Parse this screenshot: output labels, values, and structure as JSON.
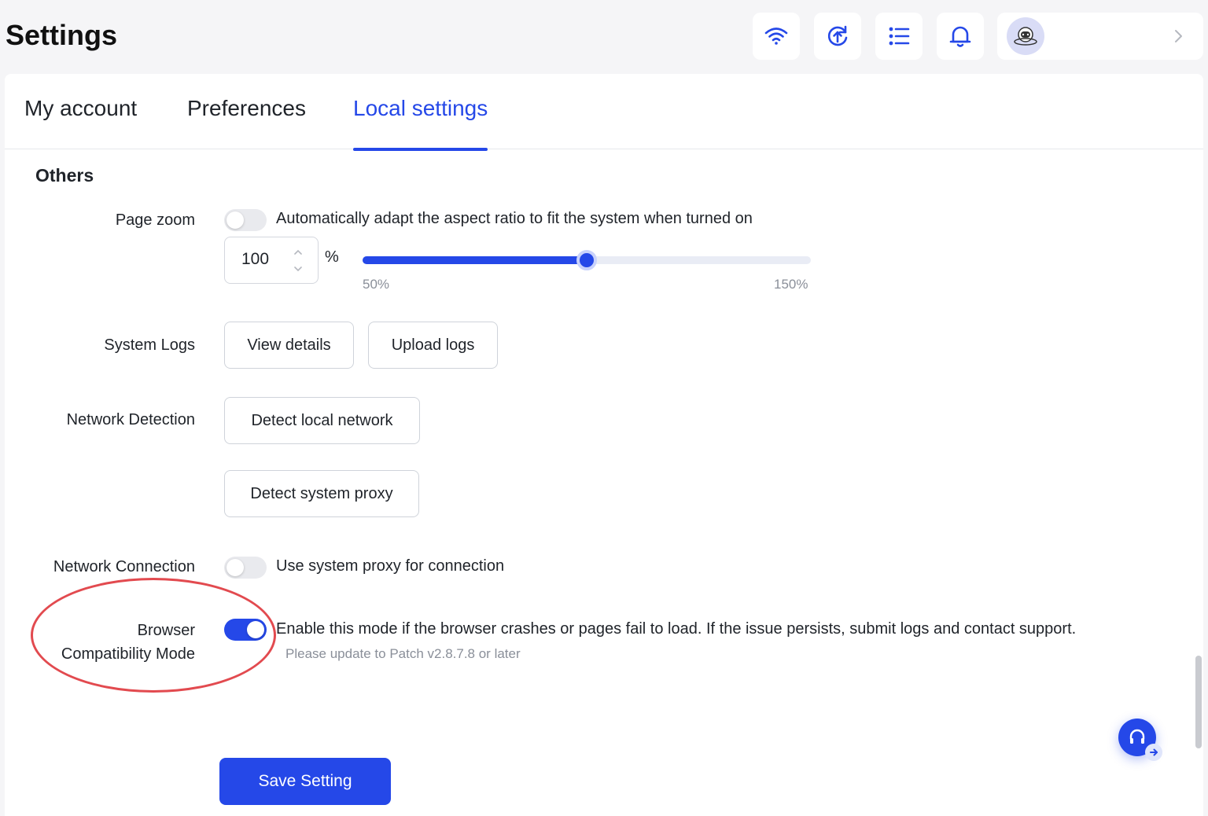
{
  "header": {
    "title": "Settings",
    "icons": [
      "wifi-icon",
      "sync-upload-icon",
      "task-list-icon",
      "bell-icon"
    ],
    "user_avatar": "astronaut-avatar"
  },
  "tabs": [
    {
      "label": "My account",
      "active": false
    },
    {
      "label": "Preferences",
      "active": false
    },
    {
      "label": "Local settings",
      "active": true
    }
  ],
  "section": {
    "title": "Others"
  },
  "page_zoom": {
    "label": "Page zoom",
    "toggle_on": false,
    "description": "Automatically adapt the aspect ratio to fit the system when turned on",
    "value": "100",
    "unit": "%",
    "slider_min_label": "50%",
    "slider_max_label": "150%",
    "slider_min": 50,
    "slider_max": 150,
    "slider_value": 100
  },
  "system_logs": {
    "label": "System Logs",
    "view_details": "View details",
    "upload_logs": "Upload logs"
  },
  "network_detection": {
    "label": "Network Detection",
    "detect_local": "Detect local network",
    "detect_proxy": "Detect system proxy"
  },
  "network_connection": {
    "label": "Network Connection",
    "toggle_on": false,
    "description": "Use system proxy for connection"
  },
  "browser_compat": {
    "label_line1": "Browser",
    "label_line2": "Compatibility Mode",
    "toggle_on": true,
    "description": "Enable this mode if the browser crashes or pages fail to load. If the issue persists, submit logs and contact support.",
    "hint": "Please update to Patch v2.8.7.8 or later"
  },
  "save_button": "Save Setting",
  "colors": {
    "accent": "#2548e8",
    "annotation": "#e24a4f"
  }
}
